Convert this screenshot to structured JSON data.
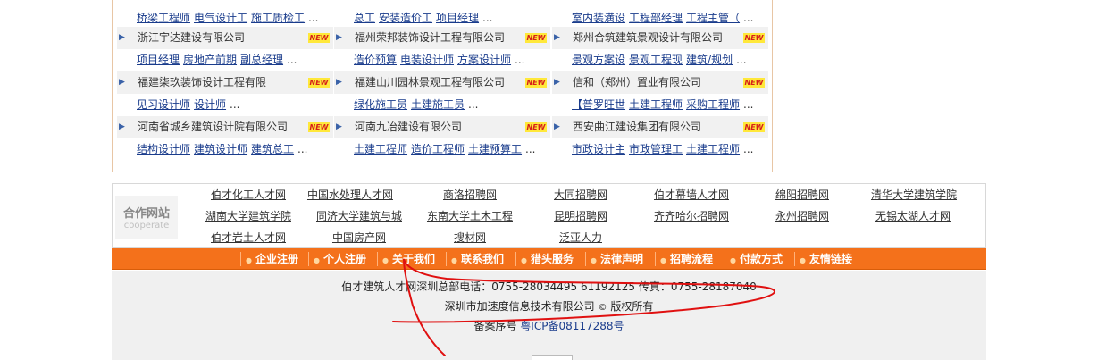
{
  "jobs": {
    "partial_top": [
      "桥梁工程师",
      "电气设计工",
      "施工质检工",
      "总工",
      "安装造价工",
      "项目经理",
      "室内装潢设",
      "工程部经理",
      "工程主管（"
    ],
    "more": "...",
    "new_label": "NEW",
    "columns": [
      [
        {
          "company": "浙江宇达建设有限公司",
          "jobs": [
            "项目经理",
            "房地产前期",
            "副总经理"
          ]
        },
        {
          "company": "福建柒玖装饰设计工程有限",
          "jobs": [
            "见习设计师",
            "设计师"
          ]
        },
        {
          "company": "河南省城乡建筑设计院有限公司",
          "jobs": [
            "结构设计师",
            "建筑设计师",
            "建筑总工"
          ]
        }
      ],
      [
        {
          "company": "福州荣邦装饰设计工程有限公司",
          "jobs": [
            "造价预算",
            "电装设计师",
            "方案设计师"
          ]
        },
        {
          "company": "福建山川园林景观工程有限公司",
          "jobs": [
            "绿化施工员",
            "土建施工员"
          ]
        },
        {
          "company": "河南九冶建设有限公司",
          "jobs": [
            "土建工程师",
            "造价工程师",
            "土建预算工"
          ]
        }
      ],
      [
        {
          "company": "郑州合筑建筑景观设计有限公司",
          "jobs": [
            "景观方案设",
            "景观工程现",
            "建筑/规划"
          ]
        },
        {
          "company": "信和（郑州）置业有限公司",
          "jobs": [
            "【普罗旺世",
            "土建工程师",
            "采购工程师"
          ]
        },
        {
          "company": "西安曲江建设集团有限公司",
          "jobs": [
            "市政设计主",
            "市政管理工",
            "土建工程师"
          ]
        }
      ]
    ]
  },
  "coop": {
    "label_cn": "合作网站",
    "label_en": "cooperate",
    "links": [
      "伯才化工人才网",
      "中国水处理人才网",
      "商洛招聘网",
      "大同招聘网",
      "伯才幕墙人才网",
      "绵阳招聘网",
      "清华大学建筑学院",
      "湖南大学建筑学院",
      "同济大学建筑与城",
      "东南大学土木工程",
      "昆明招聘网",
      "齐齐哈尔招聘网",
      "永州招聘网",
      "无锡太湖人才网",
      "伯才岩土人才网",
      "中国房产网",
      "搜材网",
      "泛亚人力"
    ]
  },
  "nav": {
    "items": [
      "企业注册",
      "个人注册",
      "关于我们",
      "联系我们",
      "猎头服务",
      "法律声明",
      "招聘流程",
      "付款方式",
      "友情链接"
    ]
  },
  "footer": {
    "line1": "伯才建筑人才网深圳总部电话：0755-28034495 61192125 传真：0755-28187040",
    "copyright_company": "深圳市加速度信息技术有限公司",
    "copyright_symbol": "©",
    "copyright_suffix": "版权所有",
    "icp_label": "备案序号",
    "icp_link": "粤ICP备08117288号"
  },
  "colors": {
    "nav_bg": "#f4711b",
    "link": "#1a3c8c",
    "annotation": "#e01010"
  }
}
